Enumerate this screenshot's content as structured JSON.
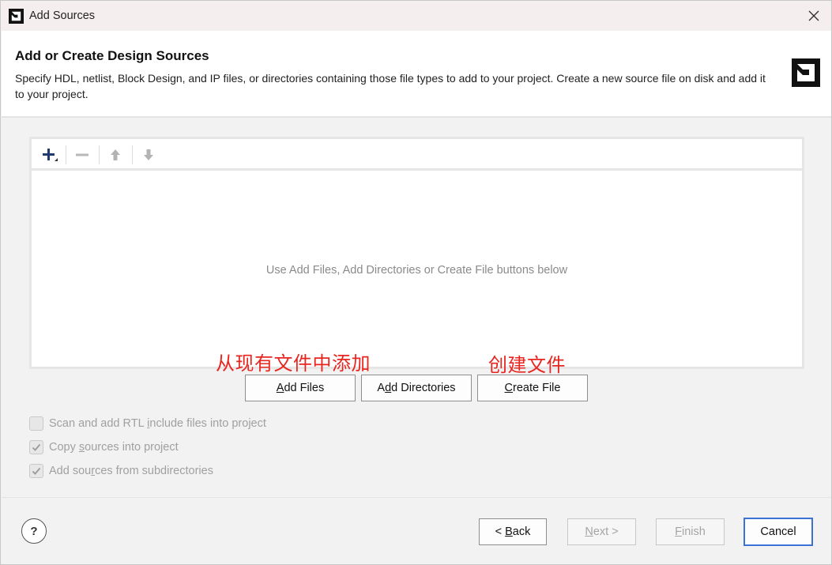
{
  "window": {
    "title": "Add Sources",
    "close_glyph": "✕"
  },
  "header": {
    "title": "Add or Create Design Sources",
    "description": "Specify HDL, netlist, Block Design, and IP files, or directories containing those file types to add to your project. Create a new source file on disk and add it to your project."
  },
  "file_panel": {
    "toolbar": {
      "icons": [
        "add-icon",
        "remove-icon",
        "move-up-icon",
        "move-down-icon"
      ]
    },
    "empty_message": "Use Add Files, Add Directories or Create File buttons below"
  },
  "annotations": {
    "add_from_existing": "从现有文件中添加",
    "create_file": "创建文件"
  },
  "actions": {
    "add_files": {
      "pre": "",
      "mnemonic": "A",
      "post": "dd Files"
    },
    "add_directories": {
      "pre": "A",
      "mnemonic": "d",
      "post": "d Directories"
    },
    "create_file": {
      "pre": "",
      "mnemonic": "C",
      "post": "reate File"
    }
  },
  "options": [
    {
      "pre": "Scan and add RTL ",
      "mnemonic": "i",
      "post": "nclude files into project",
      "checked": false
    },
    {
      "pre": "Copy ",
      "mnemonic": "s",
      "post": "ources into project",
      "checked": true
    },
    {
      "pre": "Add sou",
      "mnemonic": "r",
      "post": "ces from subdirectories",
      "checked": true
    }
  ],
  "footer": {
    "help": "?",
    "back": {
      "pre": "< ",
      "mnemonic": "B",
      "post": "ack"
    },
    "next": {
      "pre": "",
      "mnemonic": "N",
      "post": "ext >"
    },
    "finish": {
      "pre": "",
      "mnemonic": "F",
      "post": "inish"
    },
    "cancel": "Cancel"
  },
  "colors": {
    "annotation_red": "#e8251f",
    "primary_border": "#3a72d6",
    "disabled_text": "#a5a5a5"
  }
}
